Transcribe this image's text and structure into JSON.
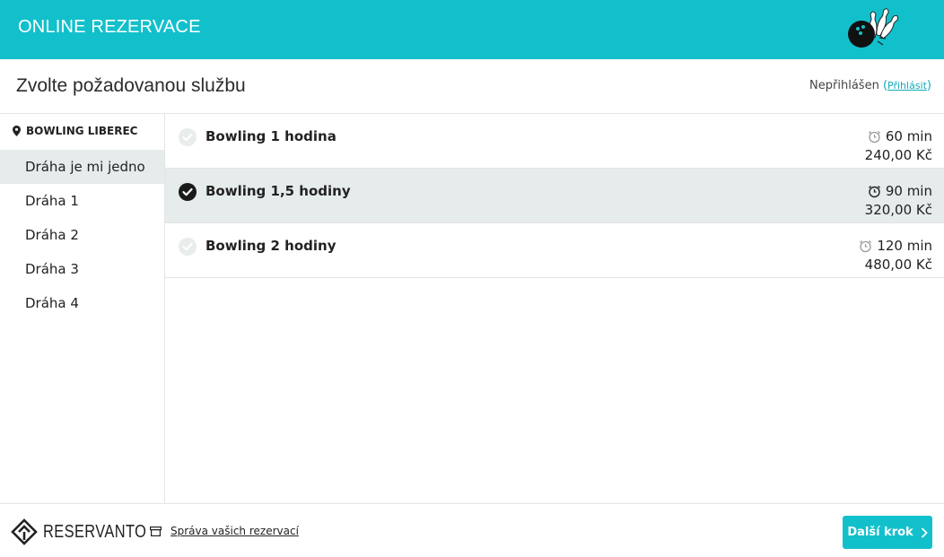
{
  "header": {
    "title": "ONLINE REZERVACE"
  },
  "subheader": {
    "title": "Zvolte požadovanou službu",
    "login_status": "Nepřihlášen",
    "login_link": "Přihlásit"
  },
  "sidebar": {
    "location": "BOWLING LIBEREC",
    "lanes": [
      {
        "label": "Dráha je mi jedno",
        "active": true
      },
      {
        "label": "Dráha 1"
      },
      {
        "label": "Dráha 2"
      },
      {
        "label": "Dráha 3"
      },
      {
        "label": "Dráha 4"
      }
    ]
  },
  "services": [
    {
      "name": "Bowling 1 hodina",
      "duration": "60 min",
      "price": "240,00 Kč",
      "selected": false
    },
    {
      "name": "Bowling 1,5 hodiny",
      "duration": "90 min",
      "price": "320,00 Kč",
      "selected": true
    },
    {
      "name": "Bowling 2 hodiny",
      "duration": "120 min",
      "price": "480,00 Kč",
      "selected": false
    }
  ],
  "footer": {
    "brand": "RESERVANTO",
    "manage_link": "Správa vašich rezervací",
    "next_button": "Další krok"
  },
  "colors": {
    "accent": "#12c0cc",
    "selected_bg": "#e6ebeb"
  }
}
